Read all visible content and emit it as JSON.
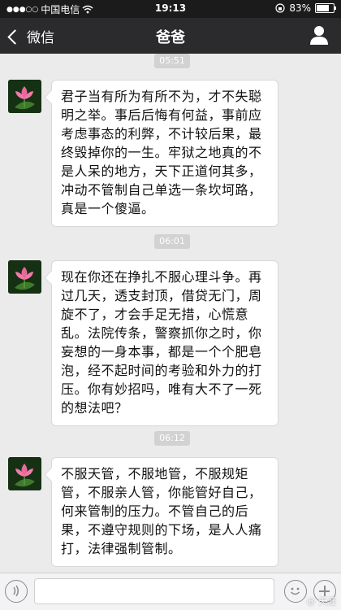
{
  "status_bar": {
    "carrier": "中国电信",
    "signal_icon": "signal-dots-icon",
    "wifi_icon": "wifi-icon",
    "time": "19:13",
    "lock_icon": "rotation-lock-icon",
    "battery": "83%",
    "battery_level": 0.83
  },
  "nav": {
    "back_label": "微信",
    "title": "爸爸",
    "profile_icon": "person-icon"
  },
  "messages": [
    {
      "timestamp": "05:51",
      "text": "君子当有所为有所不为，才不失聪明之举。事后后悔有何益，事前应考虑事态的利弊，不计较后果，最终毁掉你的一生。牢狱之地真的不是人呆的地方，天下正道何其多，冲动不管制自己单选一条坎坷路，真是一个傻逼。"
    },
    {
      "timestamp": "06:01",
      "text": "现在你还在挣扎不服心理斗争。再过几天，透支封顶，借贷无门，周旋不了，才会手足无措，心慌意乱。法院传条，警察抓你之时，你妄想的一身本事，都是一个个肥皂泡，经不起时间的考验和外力的打压。你有妙招吗，唯有大不了一死的想法吧？"
    },
    {
      "timestamp": "06:12",
      "text": "不服天管，不服地管，不服规矩管，不服亲人管，你能管好自己，何来管制的压力。不管自己的后果，不遵守规则的下场，是人人痛打，法律强制管制。"
    }
  ],
  "input_bar": {
    "voice_icon": "voice-icon",
    "emoji_icon": "emoji-icon",
    "plus_icon": "plus-icon"
  },
  "watermark": "@ 天涯"
}
